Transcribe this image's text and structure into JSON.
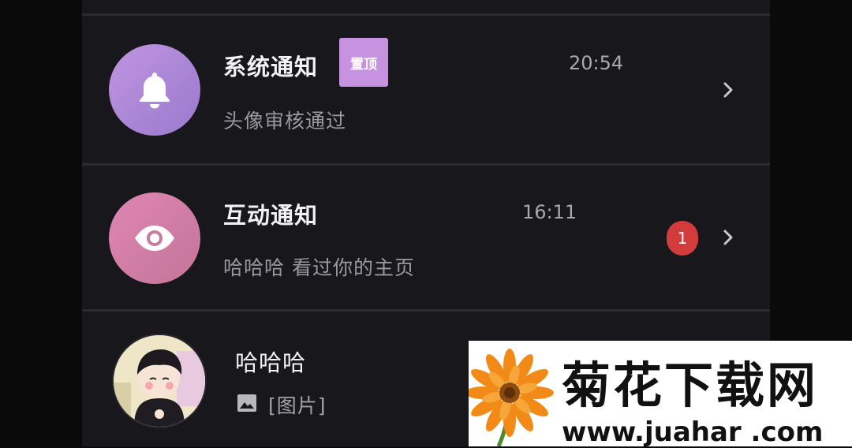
{
  "notifications": [
    {
      "title": "系统通知",
      "pin_label": "置顶",
      "time": "20:54",
      "subtitle": "头像审核通过",
      "icon": "bell-icon"
    },
    {
      "title": "互动通知",
      "time": "16:11",
      "subtitle": "哈哈哈 看过你的主页",
      "badge_count": "1",
      "icon": "eye-icon"
    }
  ],
  "chat": {
    "name": "哈哈哈",
    "preview": "[图片]",
    "icon": "image-icon"
  },
  "watermark": {
    "title": "菊花下载网",
    "url": "www.juahar .com"
  },
  "colors": {
    "bell_avatar": "#b68bd9",
    "eye_avatar": "#d47ea9",
    "pin_tag": "#c792e0",
    "badge": "#d23c3c"
  }
}
